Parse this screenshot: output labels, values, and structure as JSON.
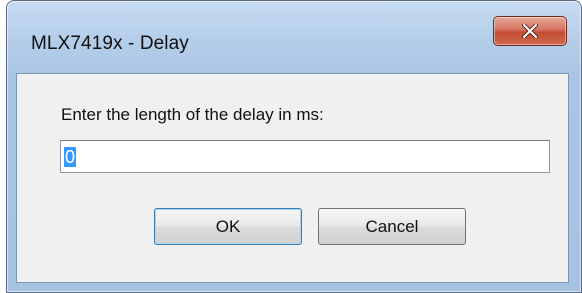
{
  "window": {
    "title": "MLX7419x - Delay"
  },
  "close_button": {
    "icon": "close-icon",
    "color": "#c24c33"
  },
  "dialog": {
    "prompt": "Enter the length of the delay in ms:",
    "delay_value": "0",
    "ok_label": "OK",
    "cancel_label": "Cancel"
  },
  "colors": {
    "selection": "#3399ff",
    "frame": "#a9c4e4"
  }
}
